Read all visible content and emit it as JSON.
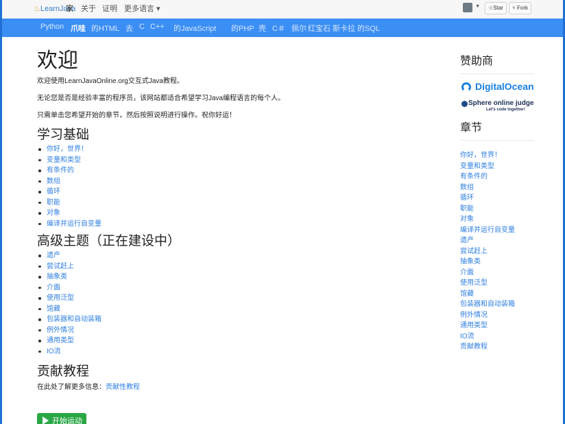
{
  "topnav": {
    "brand": "LearnJava",
    "items": [
      "家",
      "关于",
      "证明",
      "更多语言 ▾"
    ],
    "star_label": "☆Star",
    "fork_label": "Fork"
  },
  "langbar": {
    "items": [
      "Python",
      "爪哇",
      "的HTML",
      "去",
      "C",
      "C++",
      "的JavaScript",
      "的PHP",
      "壳",
      "C＃",
      "佩尔",
      "红宝石",
      "斯卡拉",
      "的SQL"
    ],
    "active_index": 1
  },
  "main": {
    "title": "欢迎",
    "intro1": "欢迎使用LearnJavaOnline.org交互式Java教程。",
    "intro2": "无论您是否是经验丰富的程序员，该网站都适合希望学习Java编程语言的每个人。",
    "intro3": "只需单击您希望开始的章节，然后按照说明进行操作。祝你好运！",
    "basics_heading": "学习基础",
    "basics": [
      "你好，世界！",
      "变量和类型",
      "有条件的",
      "数组",
      "循环",
      "职能",
      "对象",
      "编译并运行自变量"
    ],
    "advanced_heading": "高级主题（正在建设中）",
    "advanced": [
      "遗产",
      "尝试赶上",
      "抽象类",
      "介面",
      "使用泛型",
      "馆藏",
      "包装器和自动装箱",
      "例外情况",
      "通用类型",
      "IO流"
    ],
    "contrib_heading": "贡献教程",
    "contrib_text": "在此处了解更多信息：",
    "contrib_link": "贡献性教程",
    "start_button": "开始运动"
  },
  "sidebar": {
    "sponsors_heading": "赞助商",
    "sponsor1": "DigitalOcean",
    "sponsor2": "Sphere online judge",
    "sponsor2_tag": "Let's code together!",
    "chapters_heading": "章节",
    "chapters": [
      "你好，世界！",
      "变量和类型",
      "有条件的",
      "数组",
      "循环",
      "职能",
      "对象",
      "编译并运行自变量",
      "遗产",
      "尝试赶上",
      "抽象类",
      "介面",
      "使用泛型",
      "馆藏",
      "包装器和自动装箱",
      "例外情况",
      "通用类型",
      "IO流",
      "贡献教程"
    ]
  },
  "colors": {
    "langbar": "#3b8ef3",
    "link": "#2f7fe0",
    "start_button": "#2aa745",
    "digitalocean": "#1a7fe0"
  }
}
